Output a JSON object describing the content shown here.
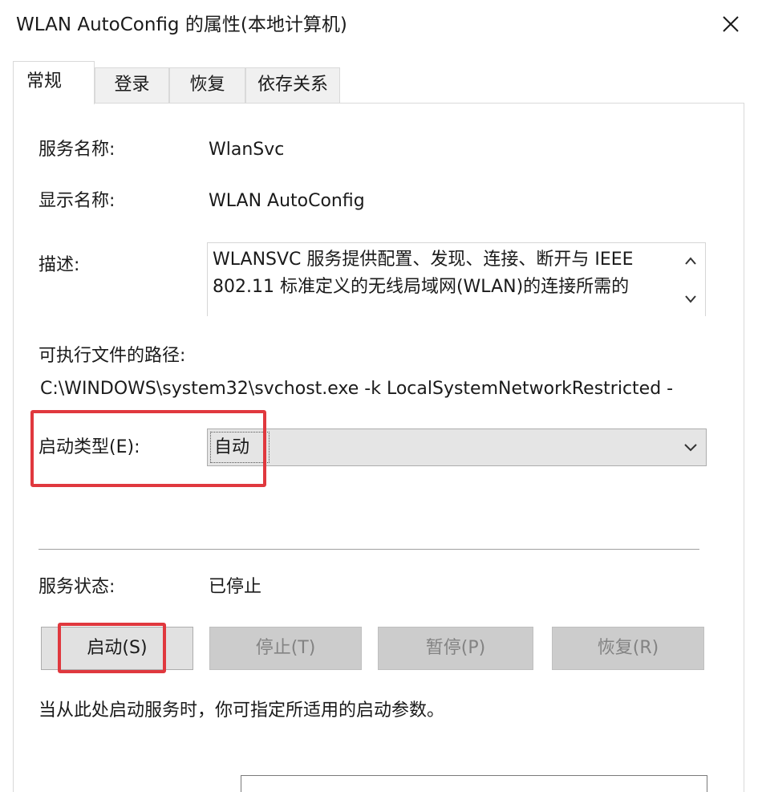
{
  "window": {
    "title": "WLAN AutoConfig 的属性(本地计算机)",
    "close_icon": "close-icon"
  },
  "tabs": [
    {
      "label": "常规",
      "active": true
    },
    {
      "label": "登录",
      "active": false
    },
    {
      "label": "恢复",
      "active": false
    },
    {
      "label": "依存关系",
      "active": false
    }
  ],
  "general": {
    "service_name_label": "服务名称:",
    "service_name_value": "WlanSvc",
    "display_name_label": "显示名称:",
    "display_name_value": "WLAN AutoConfig",
    "description_label": "描述:",
    "description_value": "WLANSVC 服务提供配置、发现、连接、断开与 IEEE 802.11 标准定义的无线局域网(WLAN)的连接所需的",
    "path_label": "可执行文件的路径:",
    "path_value": "C:\\WINDOWS\\system32\\svchost.exe -k LocalSystemNetworkRestricted -",
    "startup_type_label": "启动类型(E):",
    "startup_type_value": "自动",
    "service_status_label": "服务状态:",
    "service_status_value": "已停止",
    "buttons": {
      "start": "启动(S)",
      "stop": "停止(T)",
      "pause": "暂停(P)",
      "resume": "恢复(R)"
    },
    "hint_text": "当从此处启动服务时，你可指定所适用的启动参数。",
    "start_params_value": ""
  },
  "colors": {
    "highlight": "#e0383e",
    "disabled_button": "#cccccc",
    "combo_background": "#e5e5e5"
  }
}
